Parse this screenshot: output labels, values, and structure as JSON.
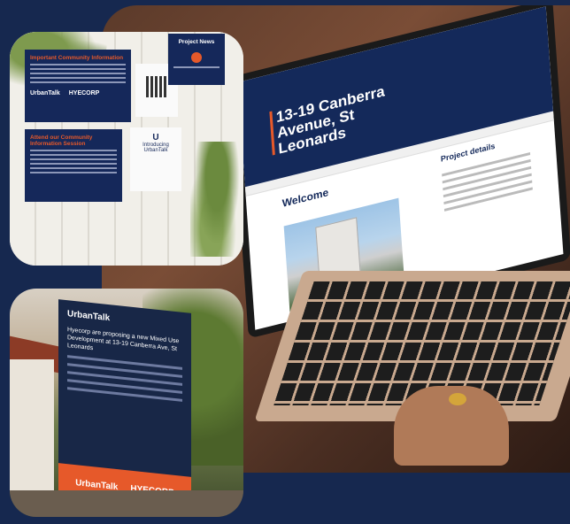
{
  "laptop_screen": {
    "title": "13-19 Canberra Avenue, St Leonards",
    "welcome": "Welcome",
    "details": "Project details"
  },
  "poster_cards": {
    "info_title": "Important Community Information",
    "session_title": "Attend our Community Information Session",
    "intro_label": "Introducing UrbanTalk",
    "project_label": "Project News"
  },
  "logos": {
    "urbantalk": "UrbanTalk",
    "hyecorp": "HYECORP"
  },
  "sign": {
    "brand": "UrbanTalk",
    "footer_brand": "UrbanTalk",
    "footer_partner": "HYECORP",
    "headline": "Hyecorp are proposing a new Mixed Use Development at 13-19 Canberra Ave, St Leonards"
  },
  "colors": {
    "navy": "#15285a",
    "accent_orange": "#e6592a",
    "background": "#16284f"
  }
}
